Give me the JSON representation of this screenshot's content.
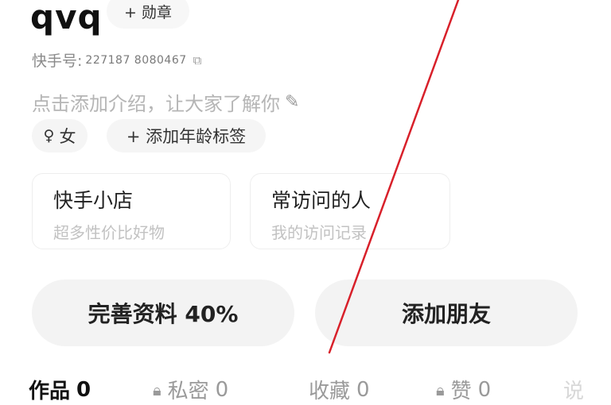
{
  "profile": {
    "username": "qvq",
    "medal_label": "+ 勋章",
    "id_label": "快手号:",
    "id_value": "227187 8080467",
    "intro_placeholder": "点击添加介绍，让大家了解你",
    "gender_symbol": "♀",
    "gender_label": "女",
    "age_tag_label": "+ 添加年龄标签"
  },
  "cards": {
    "shop": {
      "title": "快手小店",
      "subtitle": "超多性价比好物"
    },
    "visitors": {
      "title": "常访问的人",
      "subtitle": "我的访问记录"
    }
  },
  "buttons": {
    "complete_profile": "完善资料 40%",
    "add_friend": "添加朋友"
  },
  "tabs": {
    "works": {
      "label": "作品",
      "count": "0"
    },
    "private": {
      "label": "私密",
      "count": "0"
    },
    "favorites": {
      "label": "收藏",
      "count": "0"
    },
    "likes": {
      "label": "赞",
      "count": "0"
    },
    "more": {
      "label": "说"
    }
  },
  "colors": {
    "annotation_line": "#d8202a"
  }
}
